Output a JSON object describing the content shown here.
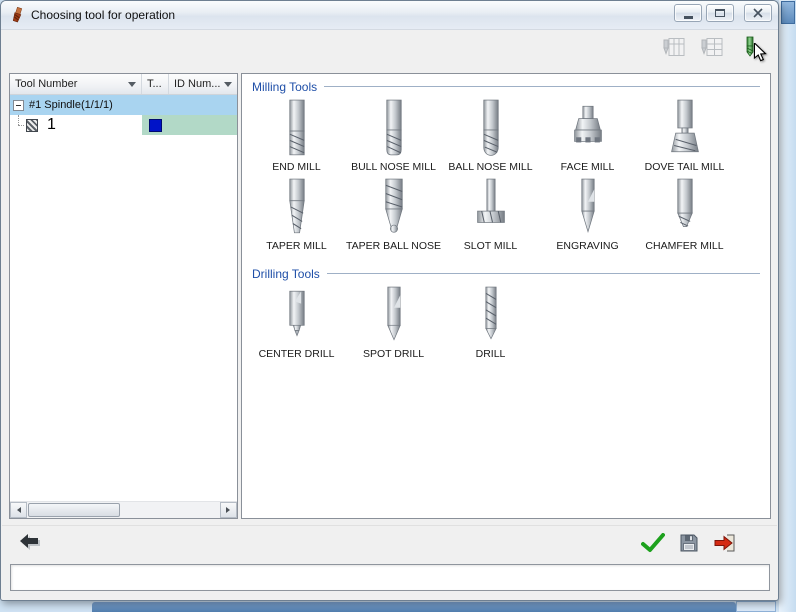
{
  "window": {
    "title": "Choosing tool for operation"
  },
  "toolbar": {
    "buttons": [
      {
        "icon": "tool-table-icon",
        "enabled": false
      },
      {
        "icon": "part-tool-table-icon",
        "enabled": false
      },
      {
        "icon": "new-tool-icon",
        "enabled": true
      }
    ]
  },
  "tool_table": {
    "columns": [
      "Tool Number",
      "T...",
      "ID Num..."
    ],
    "rows": [
      {
        "label": "#1 Spindle(1/1/1)",
        "level": 0,
        "expanded": true,
        "selected": true
      },
      {
        "label": "1",
        "level": 1,
        "tool_color": "#0013c8",
        "highlight": "#b2d9c7"
      }
    ]
  },
  "groups": [
    {
      "title": "Milling Tools",
      "items": [
        "END MILL",
        "BULL NOSE MILL",
        "BALL NOSE MILL",
        "FACE MILL",
        "DOVE TAIL MILL",
        "TAPER MILL",
        "TAPER BALL NOSE",
        "SLOT MILL",
        "ENGRAVING",
        "CHAMFER MILL"
      ]
    },
    {
      "title": "Drilling Tools",
      "items": [
        "CENTER DRILL",
        "SPOT DRILL",
        "DRILL"
      ]
    }
  ],
  "footer": {
    "buttons": [
      "back",
      "ok",
      "save",
      "exit"
    ]
  },
  "status_text": "",
  "colors": {
    "selection": "#a9d4f0",
    "assigned_cell_green": "#b2d9c7",
    "tool_color_square": "#0013c8",
    "group_label": "#1f4fa8",
    "check_green": "#1da11d",
    "exit_red": "#d42a12"
  }
}
